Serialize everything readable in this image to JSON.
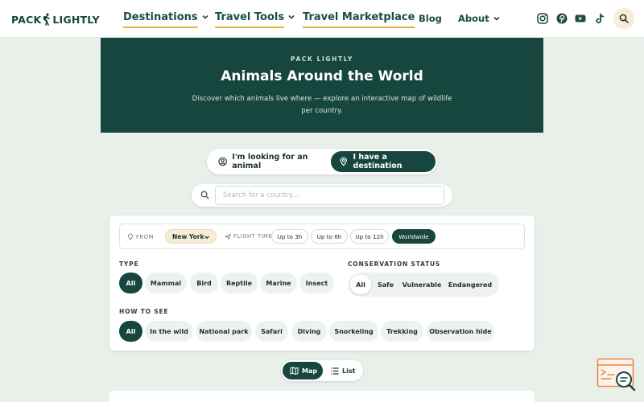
{
  "header": {
    "logo_text_left": "PACK",
    "logo_text_right": "LIGHTLY",
    "nav": [
      {
        "label": "Destinations",
        "has_dropdown": true
      },
      {
        "label": "Travel Tools",
        "has_dropdown": true
      },
      {
        "label": "Travel Marketplace",
        "has_dropdown": false
      },
      {
        "label": "Blog",
        "has_dropdown": false
      },
      {
        "label": "About",
        "has_dropdown": true
      }
    ],
    "social_icons": [
      "instagram-icon",
      "pinterest-icon",
      "youtube-icon",
      "tiktok-icon"
    ],
    "search_icon": "search-icon"
  },
  "hero": {
    "eyebrow": "PACK LIGHTLY",
    "title": "Animals Around the World",
    "subtitle": "Discover which animals live where — explore an interactive map of wildlife per country."
  },
  "mode_toggle": {
    "options": [
      "I'm looking for an animal",
      "I have a destination"
    ],
    "selected": "I have a destination"
  },
  "search": {
    "placeholder": "Search for a country..."
  },
  "filters": {
    "from_label": "FROM",
    "from_value": "New York",
    "flight_time_label": "FLIGHT TIME",
    "flight_times": [
      "Up to 3h",
      "Up to 6h",
      "Up to 12h",
      "Worldwide"
    ],
    "flight_time_selected": "Worldwide",
    "type_title": "TYPE",
    "types": [
      "All",
      "Mammal",
      "Bird",
      "Reptile",
      "Marine",
      "Insect"
    ],
    "type_selected": "All",
    "conservation_title": "CONSERVATION STATUS",
    "conservation": [
      "All",
      "Safe",
      "Vulnerable",
      "Endangered"
    ],
    "conservation_selected": "All",
    "how_title": "HOW TO SEE",
    "how": [
      "All",
      "In the wild",
      "National park",
      "Safari",
      "Diving",
      "Snorkeling",
      "Trekking",
      "Observation hide"
    ],
    "how_selected": "All"
  },
  "view_toggle": {
    "map_label": "Map",
    "list_label": "List",
    "selected": "Map"
  },
  "colors": {
    "brand_dark": "#16463d",
    "accent": "#e8b03d",
    "background": "#e9f0ea",
    "chip_bg": "#eef2ef"
  }
}
